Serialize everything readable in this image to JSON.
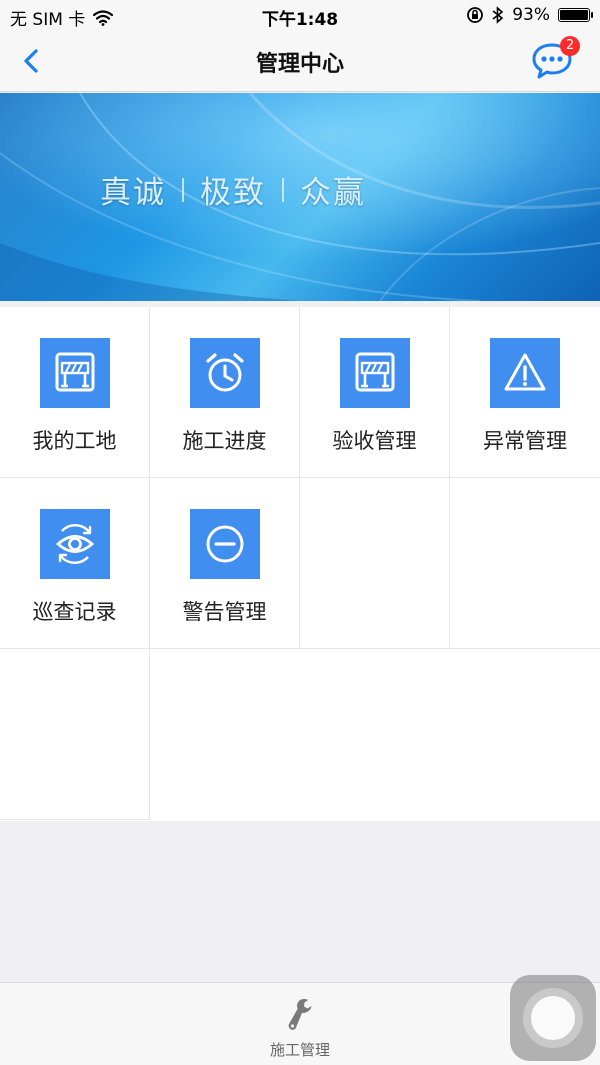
{
  "status_bar": {
    "carrier": "无 SIM 卡",
    "time": "下午1:48",
    "battery_text": "93%",
    "battery_level": 0.93,
    "icons": [
      "wifi-icon",
      "orientation-lock-icon",
      "bluetooth-icon",
      "battery-icon"
    ]
  },
  "nav": {
    "title": "管理中心",
    "back_icon": "chevron-left-icon",
    "message_icon": "chat-bubble-icon",
    "message_badge": "2"
  },
  "banner": {
    "slogan": [
      "真诚",
      "极致",
      "众赢"
    ]
  },
  "menu": [
    {
      "label": "我的工地",
      "icon": "construction-site-icon"
    },
    {
      "label": "施工进度",
      "icon": "alarm-clock-icon"
    },
    {
      "label": "验收管理",
      "icon": "construction-site-icon"
    },
    {
      "label": "异常管理",
      "icon": "warning-triangle-icon"
    },
    {
      "label": "巡查记录",
      "icon": "eye-refresh-icon"
    },
    {
      "label": "警告管理",
      "icon": "minus-circle-icon"
    }
  ],
  "tab_bar": {
    "items": [
      {
        "label": "施工管理",
        "icon": "wrench-icon"
      }
    ]
  },
  "colors": {
    "accent": "#3f8ef0",
    "nav_icon": "#1a7ff0",
    "badge": "#ff2b2b",
    "background": "#efeff4"
  }
}
